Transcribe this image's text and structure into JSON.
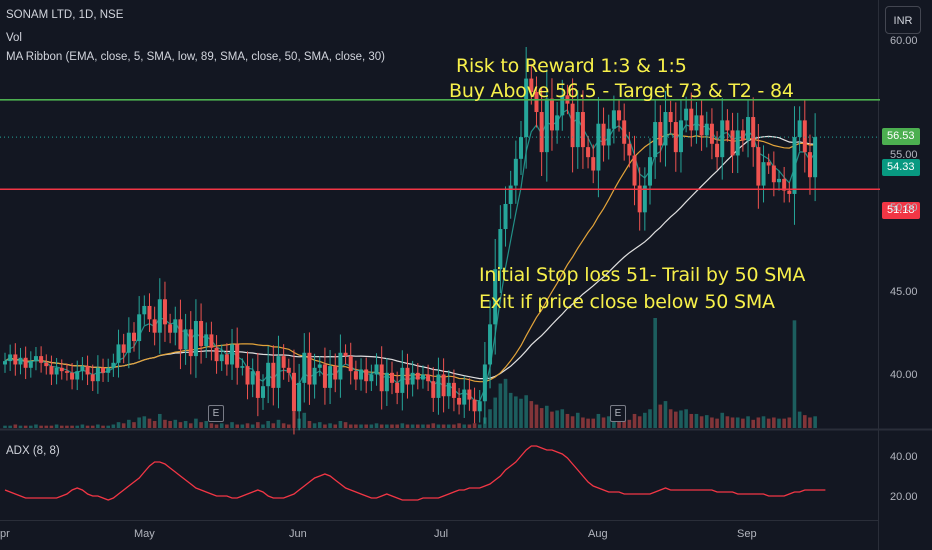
{
  "legend": {
    "symbol": "SONAM LTD, 1D, NSE",
    "vol": "Vol",
    "ma_ribbon": "MA Ribbon (EMA, close, 5, SMA, low, 89, SMA, close, 50, SMA, close, 30)",
    "adx": "ADX (8, 8)"
  },
  "currency": "INR",
  "annotations": {
    "rr": "Risk to Reward 1:3 & 1:5",
    "buy": "Buy Above 56.5 - Target 73  & T2 - 84",
    "stop": "Initial Stop loss 51- Trail by 50 SMA",
    "exit": "Exit if price close below 50 SMA"
  },
  "earnings_marker": "E",
  "price_tags": {
    "resistance": "56.53",
    "last": "54.33",
    "support": "51.18",
    "partial": "55.00"
  },
  "colors": {
    "background": "#131722",
    "up": "#26a69a",
    "down": "#ef5350",
    "resistance_line": "#4caf50",
    "support_line": "#f23645",
    "ema5": "#26a69a",
    "sma30": "#e3a43a",
    "sma50": "#e0e0e0",
    "adx": "#f23645",
    "annotation": "#f7f04a"
  },
  "chart_data": [
    {
      "type": "candlestick",
      "title": "SONAM LTD, 1D, NSE",
      "y_ticks": [
        40,
        45,
        50,
        60
      ],
      "y_tick_labels": [
        "40.00",
        "45.00",
        "50.00",
        "60.00"
      ],
      "ylim": [
        36.9,
        62.5
      ],
      "x_ticks": [
        "pr",
        "May",
        "Jun",
        "Jul",
        "Aug",
        "Sep"
      ],
      "horizontal_lines": [
        {
          "name": "resistance",
          "value": 56.53
        },
        {
          "name": "support",
          "value": 51.18
        }
      ],
      "close": [
        40.9,
        41.3,
        40.7,
        41.1,
        40.5,
        40.9,
        41.2,
        40.8,
        40.6,
        40.1,
        40.5,
        40.3,
        40.2,
        39.8,
        40.3,
        40.6,
        40.1,
        39.7,
        40.5,
        40.2,
        40.5,
        40.8,
        41.9,
        41.4,
        42.6,
        42.1,
        43.7,
        44.2,
        43.4,
        42.6,
        44.6,
        43.1,
        42.6,
        43.4,
        41.6,
        42.8,
        41.2,
        43.3,
        41.8,
        42.5,
        41.7,
        40.9,
        41.3,
        40.7,
        41.9,
        40.5,
        40.6,
        39.5,
        40.3,
        38.7,
        39.4,
        40.8,
        39.3,
        41.2,
        40.5,
        40.2,
        37.9,
        39.6,
        41.4,
        39.5,
        40.5,
        40.7,
        39.3,
        40.6,
        39.8,
        41.4,
        41.2,
        40.3,
        39.8,
        40.4,
        39.7,
        40.1,
        40.7,
        39.1,
        40.2,
        39.6,
        39.0,
        40.5,
        39.5,
        40.2,
        39.8,
        40.1,
        39.7,
        38.7,
        40.1,
        38.8,
        39.6,
        38.7,
        38.3,
        39.2,
        38.6,
        37.9,
        38.5,
        40.7,
        43.1,
        46.4,
        48.8,
        50.3,
        51.4,
        53.0,
        54.3,
        57.8,
        57.0,
        55.8,
        53.4,
        56.6,
        54.7,
        55.6,
        56.8,
        56.3,
        53.7,
        55.8,
        53.7,
        53.1,
        52.3,
        55.1,
        53.8,
        54.8,
        55.9,
        55.3,
        53.9,
        53.2,
        51.4,
        49.8,
        51.4,
        53.1,
        55.2,
        53.8,
        55.8,
        55.2,
        53.4,
        55.3,
        56.0,
        54.7,
        55.6,
        54.4,
        55.1,
        53.9,
        53.1,
        55.3,
        54.7,
        53.2,
        54.7,
        54.1,
        55.5,
        53.7,
        51.4,
        52.8,
        52.6,
        51.6,
        51.8,
        51.1,
        50.9,
        54.3,
        55.3,
        53.4,
        51.9,
        54.3
      ],
      "volume": [
        0.2,
        0.2,
        0.3,
        0.2,
        0.2,
        0.2,
        0.3,
        0.2,
        0.2,
        0.2,
        0.3,
        0.2,
        0.2,
        0.2,
        0.2,
        0.3,
        0.2,
        0.2,
        0.3,
        0.2,
        0.2,
        0.3,
        0.5,
        0.4,
        0.7,
        0.5,
        0.9,
        1.0,
        0.8,
        0.6,
        1.2,
        0.7,
        0.6,
        0.7,
        0.5,
        0.6,
        0.4,
        0.8,
        0.5,
        0.6,
        0.4,
        0.3,
        0.4,
        0.3,
        0.5,
        0.3,
        0.3,
        0.4,
        0.3,
        0.5,
        0.3,
        0.6,
        0.4,
        0.7,
        0.4,
        0.3,
        1.4,
        0.8,
        1.3,
        0.6,
        0.4,
        0.5,
        0.3,
        0.4,
        0.3,
        0.6,
        0.5,
        0.3,
        0.3,
        0.3,
        0.3,
        0.3,
        0.4,
        0.3,
        0.3,
        0.3,
        0.3,
        0.4,
        0.3,
        0.3,
        0.3,
        0.3,
        0.3,
        0.4,
        0.3,
        0.3,
        0.3,
        0.3,
        0.4,
        0.3,
        0.3,
        0.4,
        0.3,
        0.9,
        1.6,
        2.6,
        3.8,
        4.2,
        3.0,
        2.7,
        2.5,
        2.8,
        2.3,
        2.0,
        1.7,
        1.9,
        1.4,
        1.5,
        1.6,
        1.2,
        1.0,
        1.3,
        0.9,
        0.8,
        0.8,
        1.2,
        0.9,
        1.0,
        1.0,
        0.9,
        0.8,
        0.7,
        1.2,
        1.0,
        1.3,
        1.6,
        9.4,
        2.0,
        2.3,
        1.6,
        1.4,
        1.5,
        1.6,
        1.2,
        1.2,
        1.0,
        1.1,
        0.9,
        0.8,
        1.3,
        1.0,
        0.9,
        0.9,
        0.8,
        1.0,
        0.7,
        0.9,
        1.0,
        0.8,
        0.9,
        0.8,
        0.8,
        0.9,
        9.2,
        1.4,
        1.1,
        0.9,
        1.0
      ],
      "adx": [
        24,
        23,
        22,
        21,
        20,
        20,
        20,
        20,
        20,
        20,
        20,
        21,
        22,
        24,
        25,
        24,
        22,
        21,
        21,
        20,
        19,
        20,
        22,
        24,
        26,
        28,
        30,
        33,
        36,
        38,
        38,
        37,
        35,
        33,
        31,
        29,
        27,
        25,
        24,
        23,
        22,
        21,
        21,
        21,
        20,
        20,
        21,
        22,
        23,
        24,
        23,
        21,
        20,
        20,
        20,
        21,
        22,
        24,
        26,
        28,
        30,
        31,
        32,
        31,
        29,
        27,
        25,
        24,
        23,
        22,
        21,
        20,
        20,
        21,
        22,
        21,
        20,
        19,
        19,
        19,
        19,
        20,
        20,
        20,
        20,
        21,
        22,
        23,
        24,
        24,
        25,
        25,
        25,
        26,
        27,
        29,
        31,
        34,
        36,
        38,
        41,
        44,
        46,
        46,
        45,
        44,
        44,
        43,
        42,
        40,
        37,
        34,
        31,
        28,
        26,
        25,
        24,
        23,
        23,
        23,
        22,
        22,
        22,
        22,
        22,
        22,
        23,
        24,
        25,
        24,
        24,
        24,
        24,
        24,
        24,
        24,
        24,
        24,
        23,
        23,
        23,
        23,
        22,
        22,
        22,
        22,
        22,
        22,
        21,
        21,
        21,
        21,
        22,
        23,
        23,
        24,
        24,
        24,
        24,
        24
      ],
      "adx_ticks": [
        20,
        40
      ],
      "adx_tick_labels": [
        "20.00",
        "40.00"
      ]
    }
  ]
}
